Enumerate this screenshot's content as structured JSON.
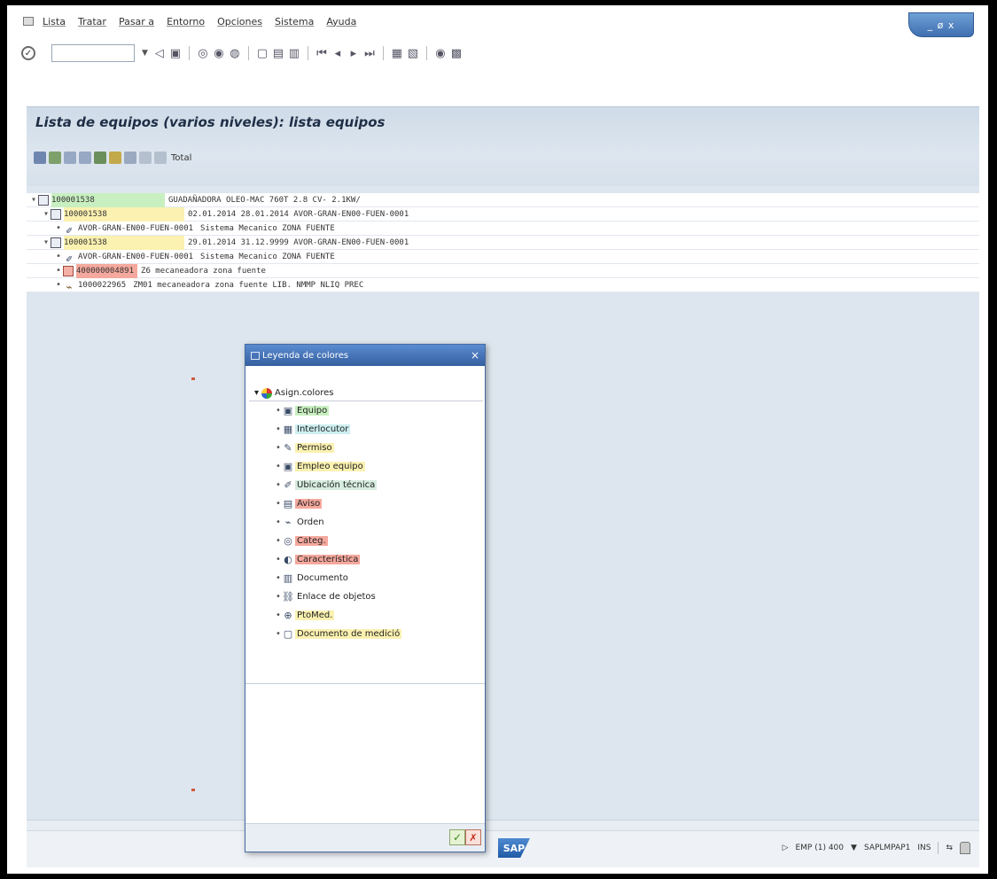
{
  "window_controls": "_ ø x",
  "menu": [
    "Lista",
    "Tratar",
    "Pasar a",
    "Entorno",
    "Opciones",
    "Sistema",
    "Ayuda"
  ],
  "page_title": "Lista de equipos (varios niveles): lista equipos",
  "app_toolbar": {
    "total_label": "Total"
  },
  "tree_rows": [
    {
      "indent": 0,
      "icon": "equipment-icon",
      "id": "100001538",
      "id_color": "green",
      "text": "GUADAÑADORA OLEO-MAC 760T 2.8 CV- 2.1KW/"
    },
    {
      "indent": 1,
      "icon": "equipment-icon",
      "id": "100001538",
      "id_color": "yellow",
      "text": "02.01.2014 28.01.2014 AVOR-GRAN-EN00-FUEN-0001"
    },
    {
      "indent": 2,
      "icon": "functional-location-icon",
      "id": "AVOR-GRAN-EN00-FUEN-0001",
      "id_color": "",
      "text": "Sistema Mecanico ZONA FUENTE"
    },
    {
      "indent": 1,
      "icon": "equipment-icon",
      "id": "100001538",
      "id_color": "yellow",
      "text": "29.01.2014 31.12.9999 AVOR-GRAN-EN00-FUEN-0001"
    },
    {
      "indent": 2,
      "icon": "functional-location-icon",
      "id": "AVOR-GRAN-EN00-FUEN-0001",
      "id_color": "",
      "text": "Sistema Mecanico ZONA FUENTE"
    },
    {
      "indent": 2,
      "icon": "notification-icon",
      "id": "400000004891",
      "id_color": "red",
      "text": "Z6 mecaneadora zona fuente"
    },
    {
      "indent": 2,
      "icon": "order-icon",
      "id": "1000022965",
      "id_color": "",
      "text": "ZM01 mecaneadora zona fuente LIB. NMMP NLIQ PREC"
    }
  ],
  "dialog": {
    "title": "Leyenda de colores",
    "close": "×",
    "root_label": "Asign.colores",
    "items": [
      {
        "label": "Equipo",
        "icon": "equipment-icon",
        "glyph": "▣",
        "bg": "#c8efc0"
      },
      {
        "label": "Interlocutor",
        "icon": "partner-icon",
        "glyph": "▦",
        "bg": "#cdeef0"
      },
      {
        "label": "Permiso",
        "icon": "permit-icon",
        "glyph": "✎",
        "bg": "#fbf1b0"
      },
      {
        "label": "Empleo equipo",
        "icon": "equipment-usage-icon",
        "glyph": "▣",
        "bg": "#fbf1b0"
      },
      {
        "label": "Ubicación técnica",
        "icon": "functional-location-icon",
        "glyph": "✐",
        "bg": "#d6ece0"
      },
      {
        "label": "Aviso",
        "icon": "notification-icon",
        "glyph": "▤",
        "bg": "#f5a89d"
      },
      {
        "label": "Orden",
        "icon": "order-icon",
        "glyph": "⌁",
        "bg": ""
      },
      {
        "label": "Categ.",
        "icon": "category-icon",
        "glyph": "◎",
        "bg": "#f5a89d"
      },
      {
        "label": "Característica",
        "icon": "characteristic-icon",
        "glyph": "◐",
        "bg": "#f5a89d"
      },
      {
        "label": "Documento",
        "icon": "document-icon",
        "glyph": "▥",
        "bg": ""
      },
      {
        "label": "Enlace de objetos",
        "icon": "object-link-icon",
        "glyph": "⛓",
        "bg": ""
      },
      {
        "label": "PtoMed.",
        "icon": "measuring-point-icon",
        "glyph": "⊕",
        "bg": "#fbf1b0"
      },
      {
        "label": "Documento de medició",
        "icon": "measurement-document-icon",
        "glyph": "▢",
        "bg": "#fbf1b0"
      }
    ],
    "ok": "✓",
    "cancel": "✗"
  },
  "status": {
    "system": "EMP (1) 400",
    "program": "SAPLMPAP1",
    "mode": "INS",
    "logo": "SAP"
  },
  "colors": {
    "green": "#c8efc0",
    "yellow": "#fbf1b0",
    "red": "#f5a89d"
  }
}
